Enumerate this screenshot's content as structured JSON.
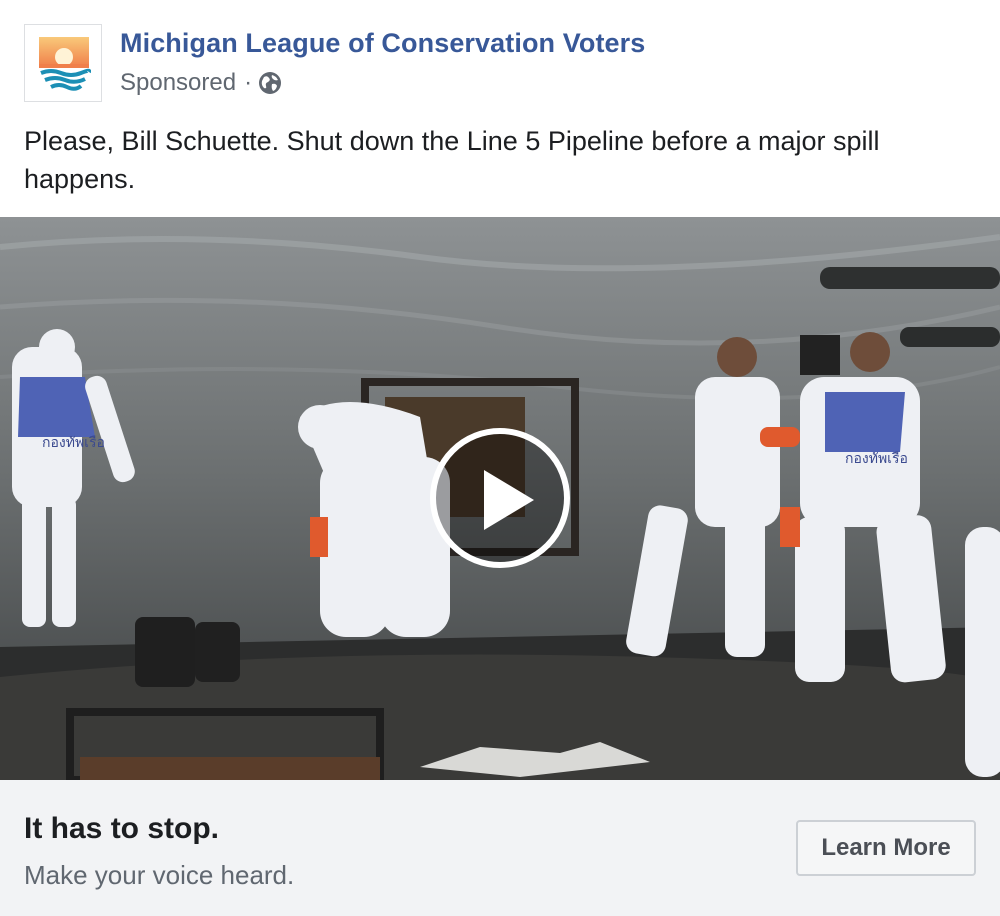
{
  "post": {
    "page_name": "Michigan League of Conservation Voters",
    "sponsored_label": "Sponsored",
    "separator": "·",
    "audience_icon": "globe-icon",
    "text": "Please, Bill Schuette. Shut down the Line 5 Pipeline before a major spill happens."
  },
  "video": {
    "play_icon": "play-icon",
    "shirt_text": "กองทัพเรือ"
  },
  "cta": {
    "headline": "It has to stop.",
    "description": "Make your voice heard.",
    "button_label": "Learn More"
  },
  "colors": {
    "page_name": "#385898",
    "meta_text": "#606770",
    "body_text": "#1c1e21",
    "cta_background": "#f2f3f5",
    "button_border": "#ccd0d5",
    "logo_sun": "#f6a45c",
    "logo_water": "#1c8fb5"
  }
}
